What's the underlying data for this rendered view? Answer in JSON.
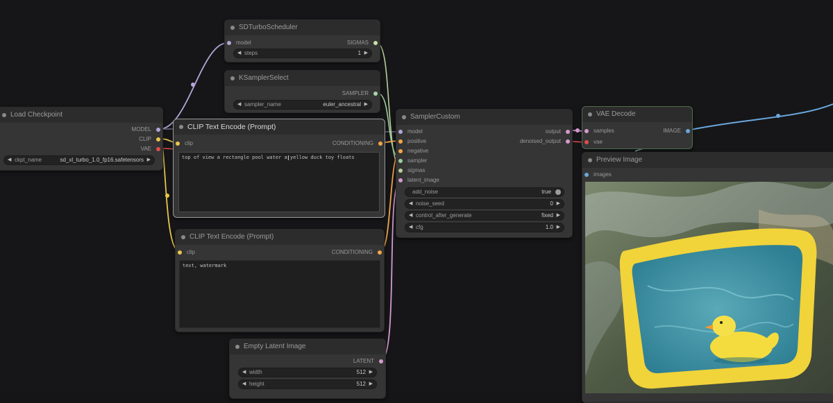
{
  "nodes": {
    "sd_turbo_scheduler": {
      "title": "SDTurboScheduler",
      "in_model": "model",
      "out_sigmas": "SIGMAS",
      "steps_label": "steps",
      "steps_value": "1"
    },
    "ksampler_select": {
      "title": "KSamplerSelect",
      "out_sampler": "SAMPLER",
      "sampler_name_label": "sampler_name",
      "sampler_name_value": "euler_ancestral"
    },
    "load_checkpoint": {
      "title": "Load Checkpoint",
      "out_model": "MODEL",
      "out_clip": "CLIP",
      "out_vae": "VAE",
      "ckpt_label": "ckpt_name",
      "ckpt_value": "sd_xl_turbo_1.0_fp16.safetensors"
    },
    "clip_pos": {
      "title": "CLIP Text Encode (Prompt)",
      "in_clip": "clip",
      "out_conditioning": "CONDITIONING",
      "text": "top of view a rectangle pool water a yellow duck toy floats"
    },
    "clip_neg": {
      "title": "CLIP Text Encode (Prompt)",
      "in_clip": "clip",
      "out_conditioning": "CONDITIONING",
      "text": "text, watermark"
    },
    "sampler_custom": {
      "title": "SamplerCustom",
      "inputs": [
        "model",
        "positive",
        "negative",
        "sampler",
        "sigmas",
        "latent_image"
      ],
      "out_output": "output",
      "out_denoised": "denoised_output",
      "add_noise_label": "add_noise",
      "add_noise_value": "true",
      "noise_seed_label": "noise_seed",
      "noise_seed_value": "0",
      "control_label": "control_after_generate",
      "control_value": "fixed",
      "cfg_label": "cfg",
      "cfg_value": "1.0"
    },
    "vae_decode": {
      "title": "VAE Decode",
      "in_samples": "samples",
      "in_vae": "vae",
      "out_image": "IMAGE"
    },
    "preview_image": {
      "title": "Preview Image",
      "in_images": "images"
    },
    "empty_latent": {
      "title": "Empty Latent Image",
      "out_latent": "LATENT",
      "width_label": "width",
      "width_value": "512",
      "height_label": "height",
      "height_value": "512"
    }
  },
  "colors": {
    "model": "#b39ddb",
    "clip": "#ffd54f",
    "vae": "#ef5350",
    "conditioning": "#ffb74d",
    "latent": "#f48fb1",
    "image": "#64b5f6",
    "sigmas": "#c5e1a5",
    "sampler": "#a5d6a7"
  },
  "icons": {
    "node_dot": "node-collapse-dot-icon",
    "widget_left": "arrow-left-icon",
    "widget_right": "arrow-right-icon",
    "text_cursor": "text-cursor-icon"
  }
}
